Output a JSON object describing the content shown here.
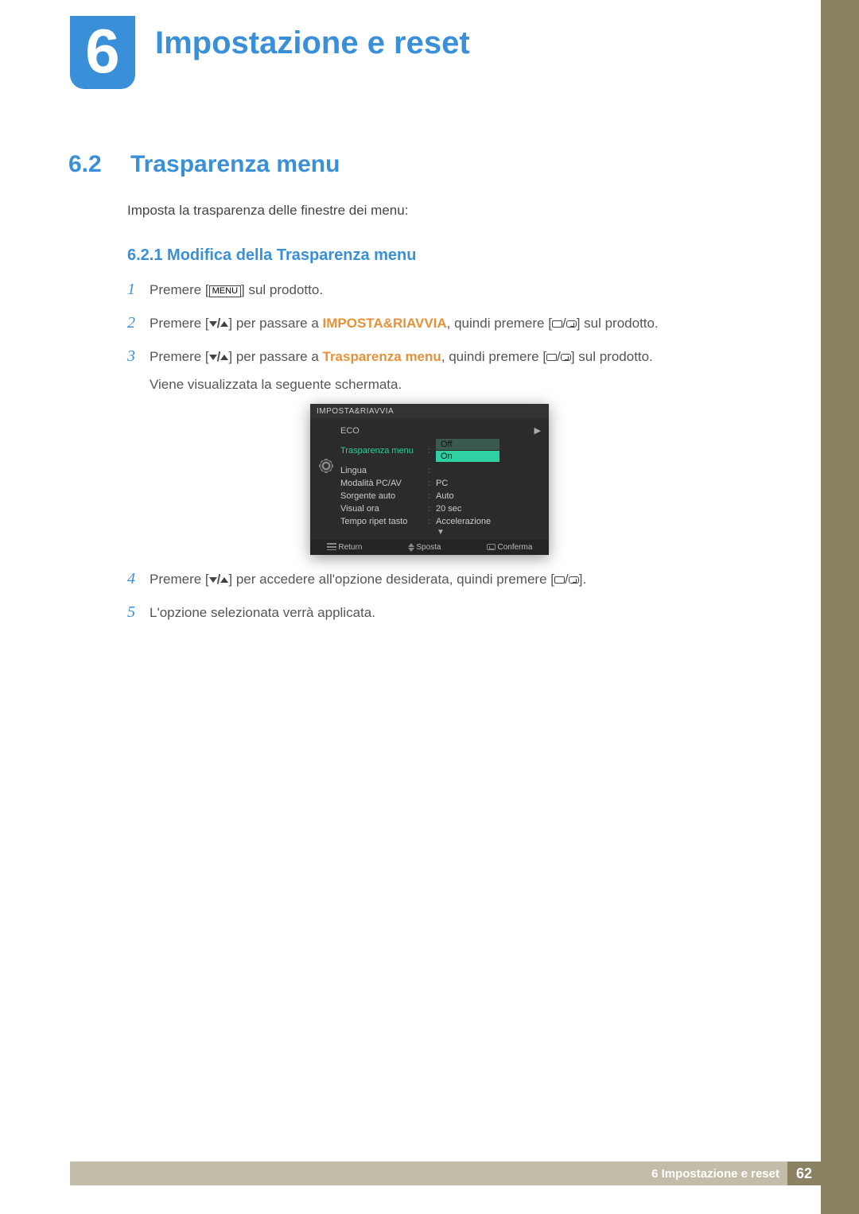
{
  "chapter": {
    "num": "6",
    "title": "Impostazione e reset"
  },
  "section": {
    "num": "6.2",
    "title": "Trasparenza menu"
  },
  "intro": "Imposta la trasparenza delle finestre dei menu:",
  "subsection": "6.2.1   Modifica della Trasparenza menu",
  "steps": {
    "s1": {
      "n": "1",
      "pre": "Premere [",
      "menu": "MENU",
      "post": "] sul prodotto."
    },
    "s2": {
      "n": "2",
      "pre": "Premere [",
      "mid": "] per passare a ",
      "hl": "IMPOSTA&RIAVVIA",
      "after": ", quindi premere [",
      "end": "] sul prodotto."
    },
    "s3": {
      "n": "3",
      "pre": "Premere [",
      "mid": "] per passare a ",
      "hl": "Trasparenza menu",
      "after": ", quindi premere [",
      "end": "] sul prodotto.",
      "cont": "Viene visualizzata la seguente schermata."
    },
    "s4": {
      "n": "4",
      "pre": "Premere [",
      "mid": "] per accedere all'opzione desiderata, quindi premere [",
      "end": "]."
    },
    "s5": {
      "n": "5",
      "text": "L'opzione selezionata verrà applicata."
    }
  },
  "osd": {
    "header": "IMPOSTA&RIAVVIA",
    "rows": {
      "eco": {
        "label": "ECO"
      },
      "trans": {
        "label": "Trasparenza menu",
        "off": "Off",
        "on": "On"
      },
      "lang": {
        "label": "Lingua",
        "value": ""
      },
      "pcav": {
        "label": "Modalità PC/AV",
        "value": "PC"
      },
      "src": {
        "label": "Sorgente auto",
        "value": "Auto"
      },
      "visual": {
        "label": "Visual ora",
        "value": "20 sec"
      },
      "tempo": {
        "label": "Tempo ripet tasto",
        "value": "Accelerazione"
      }
    },
    "footer": {
      "return": "Return",
      "move": "Sposta",
      "confirm": "Conferma"
    }
  },
  "footer": {
    "label": "6 Impostazione e reset",
    "page": "62"
  }
}
